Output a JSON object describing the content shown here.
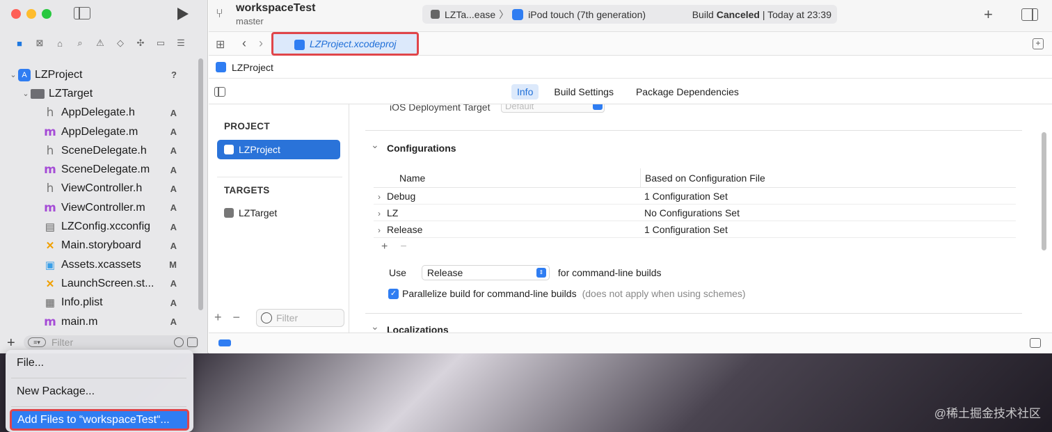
{
  "sidebar": {
    "tree": [
      {
        "label": "LZProject",
        "icon": "app-icon",
        "status": "?",
        "level": 0
      },
      {
        "label": "LZTarget",
        "icon": "folder-icon",
        "status": "",
        "level": 1
      },
      {
        "label": "AppDelegate.h",
        "icon": "h-file-icon",
        "status": "A",
        "level": 2
      },
      {
        "label": "AppDelegate.m",
        "icon": "m-file-icon",
        "status": "A",
        "level": 2
      },
      {
        "label": "SceneDelegate.h",
        "icon": "h-file-icon",
        "status": "A",
        "level": 2
      },
      {
        "label": "SceneDelegate.m",
        "icon": "m-file-icon",
        "status": "A",
        "level": 2
      },
      {
        "label": "ViewController.h",
        "icon": "h-file-icon",
        "status": "A",
        "level": 2
      },
      {
        "label": "ViewController.m",
        "icon": "m-file-icon",
        "status": "A",
        "level": 2
      },
      {
        "label": "LZConfig.xcconfig",
        "icon": "config-file-icon",
        "status": "A",
        "level": 2
      },
      {
        "label": "Main.storyboard",
        "icon": "storyboard-icon",
        "status": "A",
        "level": 2
      },
      {
        "label": "Assets.xcassets",
        "icon": "assets-icon",
        "status": "M",
        "level": 2
      },
      {
        "label": "LaunchScreen.st...",
        "icon": "storyboard-icon",
        "status": "A",
        "level": 2
      },
      {
        "label": "Info.plist",
        "icon": "plist-icon",
        "status": "A",
        "level": 2
      },
      {
        "label": "main.m",
        "icon": "m-file-icon",
        "status": "A",
        "level": 2
      }
    ],
    "filter_placeholder": "Filter"
  },
  "toolbar": {
    "workspace_title": "workspaceTest",
    "branch": "master",
    "scheme": "LZTa...ease",
    "device": "iPod touch (7th generation)",
    "build_status": "Build",
    "build_result": "Canceled",
    "build_time": "| Today at 23:39"
  },
  "tabs": {
    "file_tab": "LZProject.xcodeproj"
  },
  "breadcrumb": "LZProject",
  "editor_tabs": {
    "info": "Info",
    "build_settings": "Build Settings",
    "package_dependencies": "Package Dependencies"
  },
  "project_list": {
    "project_header": "PROJECT",
    "project_item": "LZProject",
    "targets_header": "TARGETS",
    "target_item": "LZTarget",
    "filter_placeholder": "Filter"
  },
  "content": {
    "ios_deployment_label": "iOS Deployment Target",
    "ios_deployment_value": "Default",
    "configurations_title": "Configurations",
    "col_name": "Name",
    "col_based_on": "Based on Configuration File",
    "rows": [
      {
        "name": "Debug",
        "based_on": "1 Configuration Set"
      },
      {
        "name": "LZ",
        "based_on": "No Configurations Set"
      },
      {
        "name": "Release",
        "based_on": "1 Configuration Set"
      }
    ],
    "use_label": "Use",
    "use_value": "Release",
    "use_suffix": "for command-line builds",
    "parallelize_label": "Parallelize build for command-line builds",
    "parallelize_hint": "(does not apply when using schemes)",
    "localizations_title": "Localizations"
  },
  "menu": {
    "file": "File...",
    "new_package": "New Package...",
    "add_files": "Add Files to “workspaceTest“..."
  },
  "watermark": "@稀土掘金技术社区",
  "colors": {
    "accent": "#2f7df2",
    "highlight_border": "#e0454a",
    "selection": "#2a73d9"
  }
}
